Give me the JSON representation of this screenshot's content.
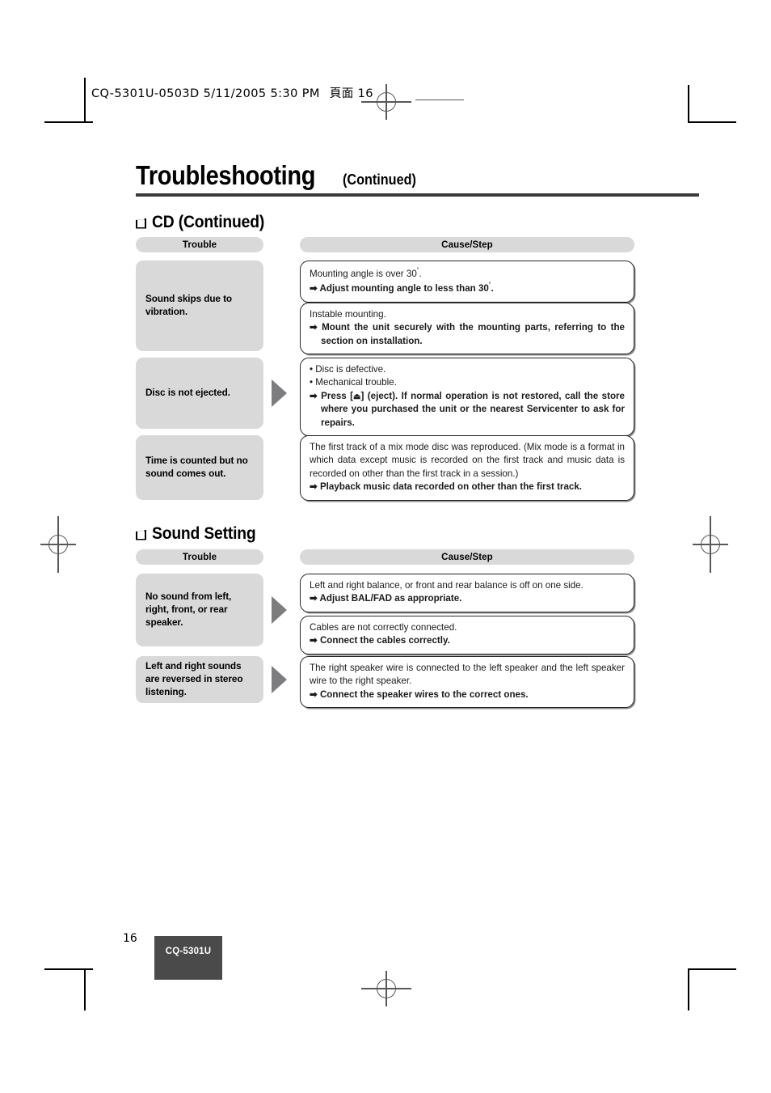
{
  "print_header": {
    "file_info": "CQ-5301U-0503D  5/11/2005  5:30 PM",
    "page_marker": "頁面 16"
  },
  "title": {
    "main": "Troubleshooting",
    "continued": "(Continued)"
  },
  "columns": {
    "trouble": "Trouble",
    "cause_step": "Cause/Step"
  },
  "sections": [
    {
      "heading": "CD (Continued)",
      "rows": [
        {
          "trouble": "Sound skips due to vibration.",
          "has_arrow": false,
          "boxes": [
            {
              "lines": [
                {
                  "kind": "plain",
                  "text": "Mounting angle is over 30˚."
                },
                {
                  "kind": "step",
                  "text": "Adjust mounting angle to less than 30˚."
                }
              ]
            },
            {
              "lines": [
                {
                  "kind": "plain",
                  "text": "Instable mounting."
                },
                {
                  "kind": "step",
                  "text": "Mount the unit securely with the mounting parts, referring to the section on installation."
                }
              ]
            }
          ]
        },
        {
          "trouble": "Disc is not ejected.",
          "has_arrow": true,
          "boxes": [
            {
              "lines": [
                {
                  "kind": "bullet",
                  "text": "Disc is defective."
                },
                {
                  "kind": "bullet",
                  "text": "Mechanical trouble."
                },
                {
                  "kind": "step",
                  "text": "Press [⏏] (eject). If normal operation is not restored, call the store where you purchased the unit or the nearest Servicenter to ask for repairs."
                }
              ]
            }
          ]
        },
        {
          "trouble": "Time is counted but no sound comes out.",
          "has_arrow": false,
          "boxes": [
            {
              "lines": [
                {
                  "kind": "plain",
                  "text": "The first track of a mix mode disc was reproduced. (Mix mode is a format in which data except music is recorded on the first track and music data is recorded on other than the first track in a session.)"
                },
                {
                  "kind": "step",
                  "text": "Playback music data recorded on other than the first track."
                }
              ]
            }
          ]
        }
      ]
    },
    {
      "heading": "Sound Setting",
      "rows": [
        {
          "trouble": "No sound from left, right, front, or rear speaker.",
          "has_arrow": true,
          "boxes": [
            {
              "lines": [
                {
                  "kind": "plain",
                  "text": "Left and right balance, or front and rear balance is off on one side."
                },
                {
                  "kind": "step",
                  "text": "Adjust BAL/FAD as appropriate."
                }
              ]
            },
            {
              "lines": [
                {
                  "kind": "plain",
                  "text": "Cables are not correctly connected."
                },
                {
                  "kind": "step",
                  "text": "Connect the cables correctly."
                }
              ]
            }
          ]
        },
        {
          "trouble": "Left and right sounds are reversed in stereo listening.",
          "has_arrow": true,
          "boxes": [
            {
              "lines": [
                {
                  "kind": "plain",
                  "text": "The right speaker wire is connected to the left speaker and the left speaker wire to the right speaker."
                },
                {
                  "kind": "step",
                  "text": "Connect the speaker wires to the correct ones."
                }
              ]
            }
          ]
        }
      ]
    }
  ],
  "footer": {
    "page_number": "16",
    "model": "CQ-5301U"
  },
  "colors": {
    "gray_fill": "#d9d9d9",
    "arrow_gray": "#7d7d7f",
    "rule_dark": "#3a3a3c",
    "badge_bg": "#4a4a4a"
  }
}
